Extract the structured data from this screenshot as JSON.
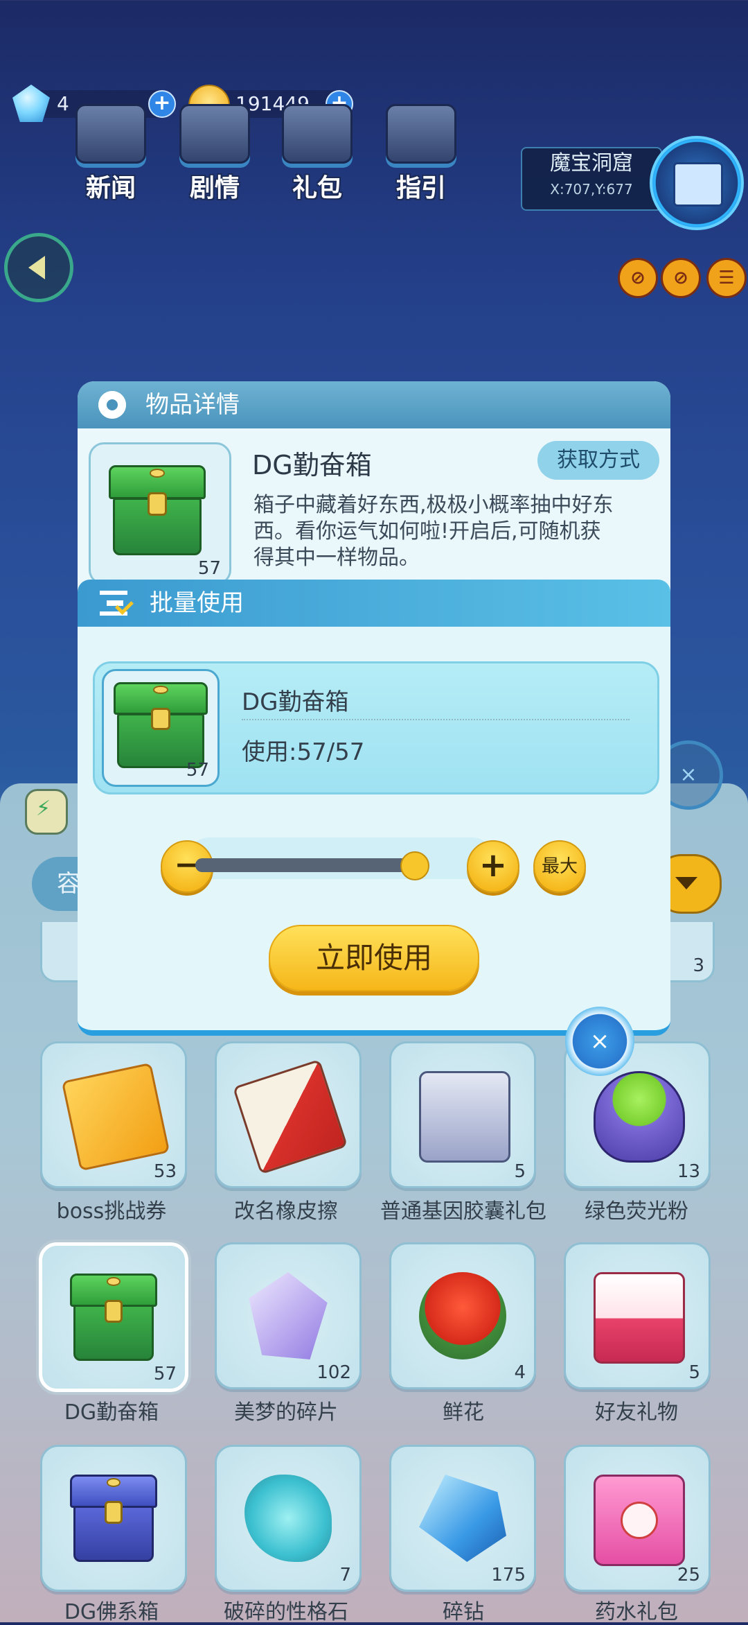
{
  "hud": {
    "gems": "4",
    "coins": "191449",
    "plus": "+",
    "buttons": [
      {
        "label": "新闻"
      },
      {
        "label": "剧情"
      },
      {
        "label": "礼包"
      },
      {
        "label": "指引"
      }
    ],
    "location": {
      "name": "魔宝洞窟",
      "coords": "X:707,Y:677"
    }
  },
  "detail": {
    "title": "物品详情",
    "item_name": "DG勤奋箱",
    "count": "57",
    "get_button": "获取方式",
    "description": "箱子中藏着好东西,极极小概率抽中好东西。看你运气如何啦!开启后,可随机获得其中一样物品。"
  },
  "batch": {
    "title": "批量使用",
    "item_name": "DG勤奋箱",
    "count": "57",
    "usage": "使用:57/57",
    "slider_fraction": 1.0,
    "minus": "−",
    "plus": "+",
    "max_label": "最大",
    "use_button": "立即使用",
    "close": "×"
  },
  "inventory": {
    "tab_label": "容",
    "partial_row_count": "3",
    "items": [
      {
        "name": "boss挑战券",
        "count": "53",
        "icon": "ticket-icon"
      },
      {
        "name": "改名橡皮擦",
        "count": "",
        "icon": "eraser-icon"
      },
      {
        "name": "普通基因胶囊礼包",
        "count": "5",
        "icon": "capsule-icon"
      },
      {
        "name": "绿色荧光粉",
        "count": "13",
        "icon": "bowl-icon"
      },
      {
        "name": "DG勤奋箱",
        "count": "57",
        "icon": "chest-icon"
      },
      {
        "name": "美梦的碎片",
        "count": "102",
        "icon": "crystal-icon"
      },
      {
        "name": "鲜花",
        "count": "4",
        "icon": "rose-icon"
      },
      {
        "name": "好友礼物",
        "count": "5",
        "icon": "gift-icon"
      },
      {
        "name": "DG佛系箱",
        "count": "",
        "icon": "chest-blue-icon"
      },
      {
        "name": "破碎的性格石",
        "count": "7",
        "icon": "gems-icon"
      },
      {
        "name": "碎钻",
        "count": "175",
        "icon": "shard-icon"
      },
      {
        "name": "药水礼包",
        "count": "25",
        "icon": "potion-icon"
      }
    ]
  }
}
